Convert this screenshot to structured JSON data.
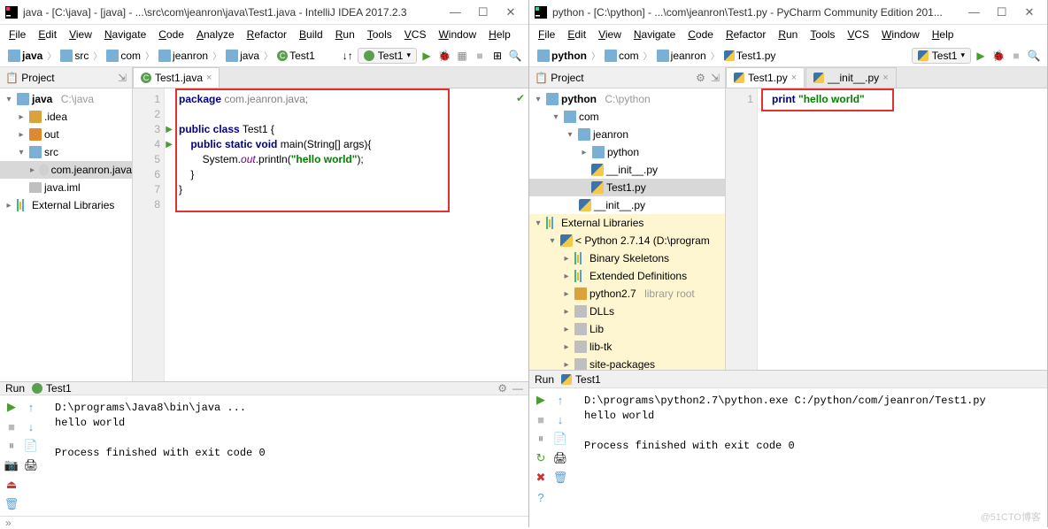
{
  "left": {
    "title": "java - [C:\\java] - [java] - ...\\src\\com\\jeanron\\java\\Test1.java - IntelliJ IDEA 2017.2.3",
    "menus": [
      "File",
      "Edit",
      "View",
      "Navigate",
      "Code",
      "Analyze",
      "Refactor",
      "Build",
      "Run",
      "Tools",
      "VCS",
      "Window",
      "Help"
    ],
    "breadcrumbs": [
      "java",
      "src",
      "com",
      "jeanron",
      "java",
      "Test1"
    ],
    "runcfg": "Test1",
    "project_label": "Project",
    "tree": {
      "root": "java",
      "root_path": "C:\\java",
      "idea": ".idea",
      "out": "out",
      "src": "src",
      "pkg": "com.jeanron.java",
      "iml": "java.iml",
      "ext": "External Libraries"
    },
    "tab": "Test1.java",
    "code": {
      "l1a": "package",
      "l1b": " com.jeanron.java;",
      "l3": "public class",
      "l3b": " Test1 {",
      "l4": "    public static void",
      "l4b": " main(String[] args){",
      "l5a": "        System.",
      "l5b": "out",
      "l5c": ".println(",
      "l5d": "\"hello world\"",
      "l5e": ");",
      "l6": "    }",
      "l7": "}"
    },
    "run_label": "Run",
    "run_name": "Test1",
    "console": "D:\\programs\\Java8\\bin\\java ...\nhello world\n\nProcess finished with exit code 0"
  },
  "right": {
    "title": "python - [C:\\python] - ...\\com\\jeanron\\Test1.py - PyCharm Community Edition 201...",
    "menus": [
      "File",
      "Edit",
      "View",
      "Navigate",
      "Code",
      "Refactor",
      "Run",
      "Tools",
      "VCS",
      "Window",
      "Help"
    ],
    "breadcrumbs": [
      "python",
      "com",
      "jeanron",
      "Test1.py"
    ],
    "runcfg": "Test1",
    "project_label": "Project",
    "tree": {
      "root": "python",
      "root_path": "C:\\python",
      "com": "com",
      "jeanron": "jeanron",
      "python": "python",
      "init1": "__init__.py",
      "test1": "Test1.py",
      "init2": "__init__.py",
      "ext": "External Libraries",
      "pyver": "< Python 2.7.14 (D:\\program",
      "bs": "Binary Skeletons",
      "ed": "Extended Definitions",
      "p27": "python2.7",
      "p27lib": "library root",
      "dlls": "DLLs",
      "lib": "Lib",
      "libtk": "lib-tk",
      "sp": "site-packages"
    },
    "tab1": "Test1.py",
    "tab2": "__init__.py",
    "code": {
      "l1a": "print",
      "l1b": " ",
      "l1c": "\"hello world\""
    },
    "run_label": "Run",
    "run_name": "Test1",
    "console": "D:\\programs\\python2.7\\python.exe C:/python/com/jeanron/Test1.py\nhello world\n\nProcess finished with exit code 0",
    "watermark": "@51CTO博客"
  }
}
